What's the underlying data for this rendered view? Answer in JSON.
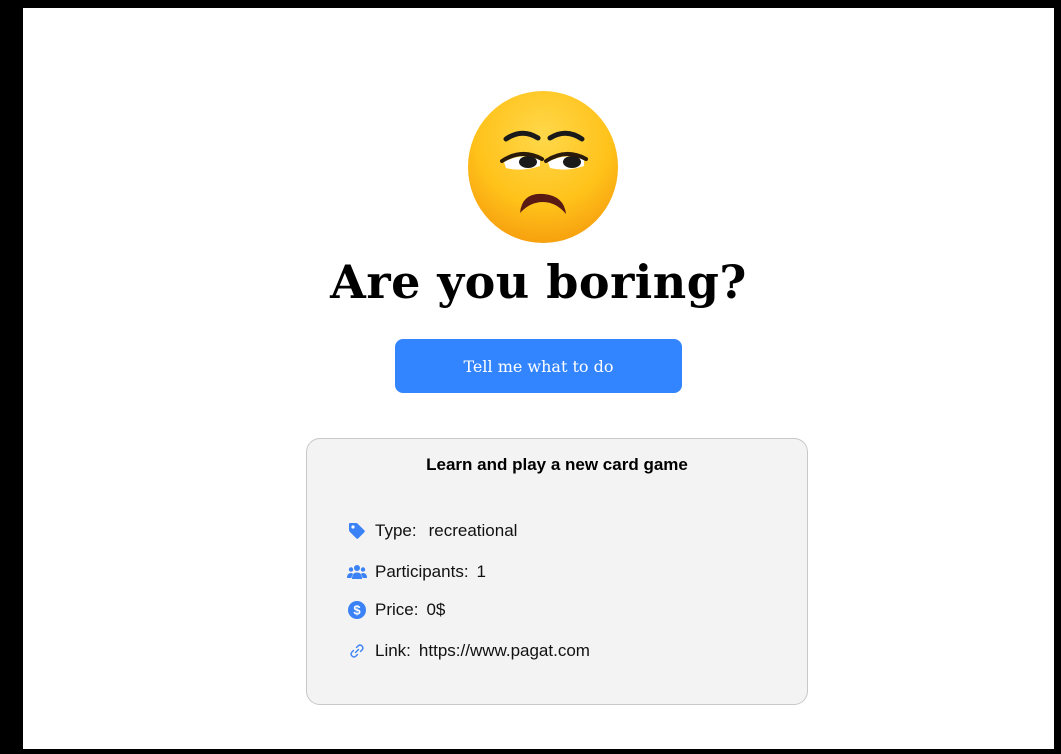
{
  "header": {
    "title": "Are you boring?"
  },
  "cta": {
    "label": "Tell me what to do"
  },
  "activity": {
    "title": "Learn and play a new card game",
    "type_label": "Type:",
    "type_value": "recreational",
    "participants_label": "Participants:",
    "participants_value": "1",
    "price_label": "Price:",
    "price_value": "0$",
    "link_label": "Link:",
    "link_value": "https://www.pagat.com"
  },
  "icons": {
    "emoji": "unamused-face-icon",
    "type": "tag-icon",
    "participants": "users-icon",
    "price": "dollar-circle-icon",
    "link": "link-icon"
  },
  "colors": {
    "accent": "#3385ff",
    "card_bg": "#f3f3f3",
    "icon_blue": "#3b82f6"
  }
}
